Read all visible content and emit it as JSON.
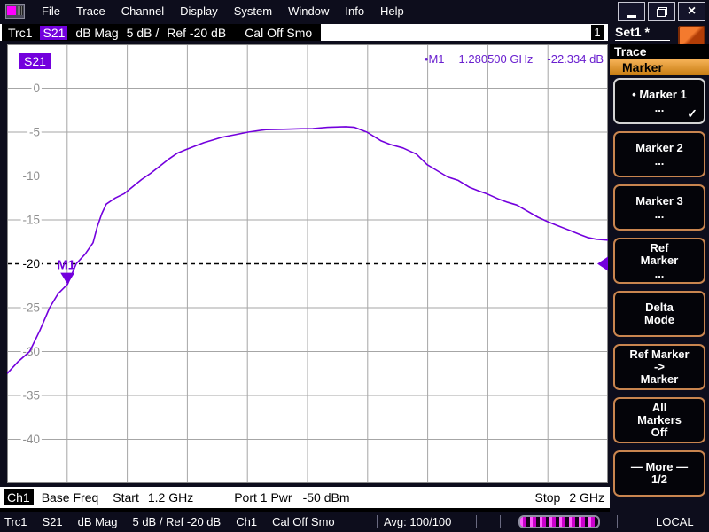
{
  "app": {
    "menu": [
      "File",
      "Trace",
      "Channel",
      "Display",
      "System",
      "Window",
      "Info",
      "Help"
    ]
  },
  "trace_bar": {
    "trace_name": "Trc1",
    "parameter": "S21",
    "format": "dB Mag",
    "scale": "5 dB /",
    "ref": "Ref -20 dB",
    "cal_state": "Cal Off Smo",
    "window_number": "1"
  },
  "sidebar": {
    "setup_name": "Set1 *",
    "menu_title": "Trace",
    "active_submenu": "Marker",
    "buttons": [
      {
        "label": "• Marker 1",
        "sub": "...",
        "check": "✓"
      },
      {
        "label": "Marker 2",
        "sub": "..."
      },
      {
        "label": "Marker 3",
        "sub": "..."
      },
      {
        "label": "Ref\nMarker",
        "sub": "..."
      },
      {
        "label": "Delta\nMode",
        "sub": ""
      },
      {
        "label": "Ref Marker\n->\nMarker",
        "sub": ""
      },
      {
        "label": "All\nMarkers\nOff",
        "sub": ""
      },
      {
        "label": "— More —\n1/2",
        "sub": ""
      }
    ]
  },
  "chart_data": {
    "type": "line",
    "title": "S21 dB Mag, 5 dB/div, Ref -20 dB",
    "trace_label": "S21",
    "trace_color": "#7300dd",
    "x_start_ghz": 1.2,
    "x_stop_ghz": 2.0,
    "x_divisions": 10,
    "y_top_db": 5,
    "y_bottom_db": -45,
    "scale_per_div_db": 5,
    "y_ticks": [
      0,
      -5,
      -10,
      -15,
      -20,
      -25,
      -30,
      -35,
      -40
    ],
    "ref_level_db": -20,
    "grid": true,
    "marker": {
      "name": "M1",
      "label": "•M1",
      "freq_ghz": 1.2805,
      "value_db": -22.334,
      "readout_freq": "1.280500 GHz",
      "readout_value": "-22.334 dB"
    },
    "series": [
      {
        "name": "S21",
        "points": [
          [
            1.2,
            -32.5
          ],
          [
            1.214,
            -31.2
          ],
          [
            1.23,
            -30.0
          ],
          [
            1.2437,
            -27.6
          ],
          [
            1.2566,
            -25.0
          ],
          [
            1.268,
            -23.4
          ],
          [
            1.2805,
            -22.334
          ],
          [
            1.292,
            -20.0
          ],
          [
            1.304,
            -18.9
          ],
          [
            1.3145,
            -17.6
          ],
          [
            1.32,
            -15.8
          ],
          [
            1.326,
            -14.3
          ],
          [
            1.332,
            -13.2
          ],
          [
            1.344,
            -12.5
          ],
          [
            1.356,
            -12.0
          ],
          [
            1.3675,
            -11.2
          ],
          [
            1.379,
            -10.4
          ],
          [
            1.391,
            -9.7
          ],
          [
            1.403,
            -8.9
          ],
          [
            1.4147,
            -8.1
          ],
          [
            1.4265,
            -7.4
          ],
          [
            1.438,
            -7.0
          ],
          [
            1.45,
            -6.6
          ],
          [
            1.462,
            -6.2
          ],
          [
            1.474,
            -5.9
          ],
          [
            1.4855,
            -5.6
          ],
          [
            1.497,
            -5.4
          ],
          [
            1.509,
            -5.2
          ],
          [
            1.521,
            -5.0
          ],
          [
            1.533,
            -4.85
          ],
          [
            1.5445,
            -4.72
          ],
          [
            1.568,
            -4.68
          ],
          [
            1.592,
            -4.62
          ],
          [
            1.607,
            -4.6
          ],
          [
            1.627,
            -4.45
          ],
          [
            1.6507,
            -4.38
          ],
          [
            1.6625,
            -4.45
          ],
          [
            1.679,
            -5.0
          ],
          [
            1.698,
            -6.0
          ],
          [
            1.71,
            -6.4
          ],
          [
            1.727,
            -6.8
          ],
          [
            1.745,
            -7.5
          ],
          [
            1.759,
            -8.7
          ],
          [
            1.7746,
            -9.5
          ],
          [
            1.7864,
            -10.1
          ],
          [
            1.8006,
            -10.5
          ],
          [
            1.816,
            -11.3
          ],
          [
            1.8277,
            -11.7
          ],
          [
            1.8395,
            -12.05
          ],
          [
            1.8537,
            -12.6
          ],
          [
            1.8667,
            -13.0
          ],
          [
            1.8785,
            -13.3
          ],
          [
            1.8926,
            -14.0
          ],
          [
            1.9068,
            -14.7
          ],
          [
            1.9198,
            -15.2
          ],
          [
            1.934,
            -15.7
          ],
          [
            1.9493,
            -16.2
          ],
          [
            1.9634,
            -16.7
          ],
          [
            1.9729,
            -17.0
          ],
          [
            1.9847,
            -17.2
          ],
          [
            2.0,
            -17.3
          ]
        ]
      }
    ]
  },
  "channel_bar": {
    "channel": "Ch1",
    "sweep_type": "Base Freq",
    "start_label": "Start",
    "start_value": "1.2 GHz",
    "power_label": "Port 1 Pwr",
    "power_value": "-50 dBm",
    "stop_label": "Stop",
    "stop_value": "2 GHz"
  },
  "status_bar": {
    "trace": "Trc1",
    "parameter": "S21",
    "format": "dB Mag",
    "scale_ref": "5 dB / Ref -20 dB",
    "channel": "Ch1",
    "cal_state": "Cal Off Smo",
    "avg": "Avg: 100/100",
    "mode": "LOCAL"
  },
  "colors": {
    "trace_violet": "#7300dd",
    "accent_magenta": "#ff00ff",
    "submenu_gold": "#e39a2e",
    "softkey_border": "#c9854f"
  }
}
